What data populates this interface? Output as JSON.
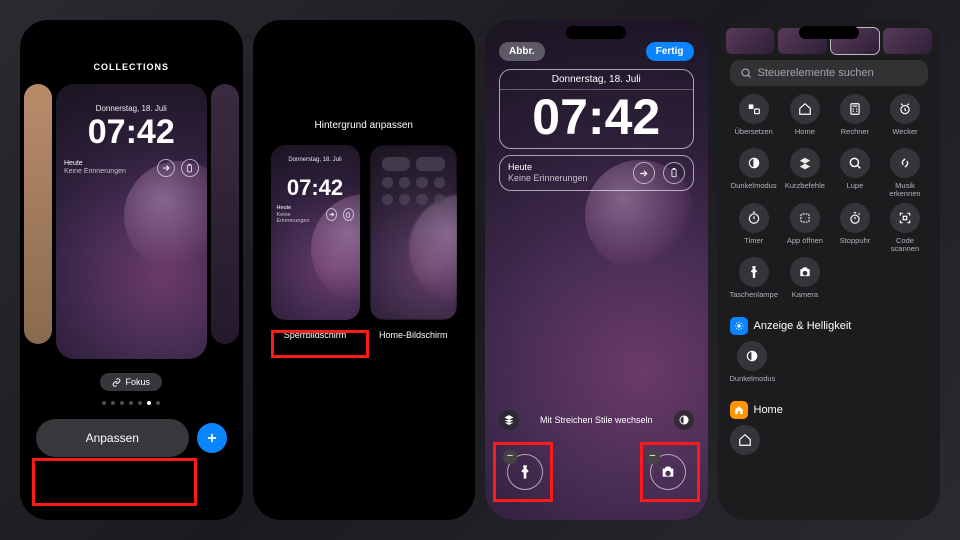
{
  "panel1": {
    "header": "COLLECTIONS",
    "date": "Donnerstag, 18. Juli",
    "time": "07:42",
    "today_label": "Heute",
    "today_sub": "Keine Erinnerungen",
    "focus_label": "Fokus",
    "dots_total": 7,
    "dots_active_index": 5,
    "customize_label": "Anpassen"
  },
  "panel2": {
    "title": "Hintergrund anpassen",
    "date": "Donnerstag, 18. Juli",
    "time": "07:42",
    "today_label": "Heute",
    "today_sub": "Keine Erinnerungen",
    "lock_label": "Sperrbildschirm",
    "home_label": "Home-Bildschirm"
  },
  "panel3": {
    "cancel": "Abbr.",
    "done": "Fertig",
    "date": "Donnerstag, 18. Juli",
    "time": "07:42",
    "today_label": "Heute",
    "today_sub": "Keine Erinnerungen",
    "styles_hint": "Mit Streichen Stile wechseln"
  },
  "panel4": {
    "search_placeholder": "Steuerelemente suchen",
    "controls": [
      {
        "id": "translate",
        "label": "Übersetzen"
      },
      {
        "id": "home",
        "label": "Home"
      },
      {
        "id": "calculator",
        "label": "Rechner"
      },
      {
        "id": "alarm",
        "label": "Wecker"
      },
      {
        "id": "darkmode",
        "label": "Dunkelmodus"
      },
      {
        "id": "shortcuts",
        "label": "Kurzbefehle"
      },
      {
        "id": "magnifier",
        "label": "Lupe"
      },
      {
        "id": "shazam",
        "label": "Musik erkennen"
      },
      {
        "id": "timer",
        "label": "Timer"
      },
      {
        "id": "appopen",
        "label": "App öffnen"
      },
      {
        "id": "stopwatch",
        "label": "Stoppuhr"
      },
      {
        "id": "scancode",
        "label": "Code scannen"
      },
      {
        "id": "flashlight",
        "label": "Taschenlampe"
      },
      {
        "id": "camera",
        "label": "Kamera"
      }
    ],
    "section_display": "Anzeige & Helligkeit",
    "display_item": "Dunkelmodus",
    "section_home": "Home"
  }
}
